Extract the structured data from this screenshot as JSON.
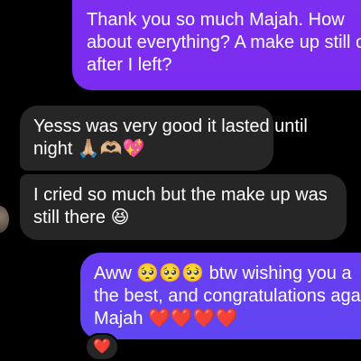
{
  "conversation": {
    "messages": [
      {
        "sender": "me",
        "lines": [
          "Thank you so much Majah. How",
          "about everything? A make up still o",
          "after I left?"
        ]
      },
      {
        "sender": "them",
        "lines": [
          "Yesss was very good it lasted until",
          "night 🙏🏼🫶🏼💖"
        ]
      },
      {
        "sender": "them",
        "lines": [
          "I cried so much but the make up was",
          "still there 😆"
        ]
      },
      {
        "sender": "me",
        "lines": [
          "Aww 🥺🥺🥺 btw wishing  you a",
          "the best, and congratulations aga",
          "Majah ❤️❤️❤️❤️"
        ]
      }
    ],
    "reaction": "❤️"
  },
  "colors": {
    "background": "#000000",
    "sent_bubble": "#7a2df0",
    "sent_bubble_bottom": "#5f47f3",
    "received_bubble": "#262626",
    "text": "#ffffff"
  }
}
